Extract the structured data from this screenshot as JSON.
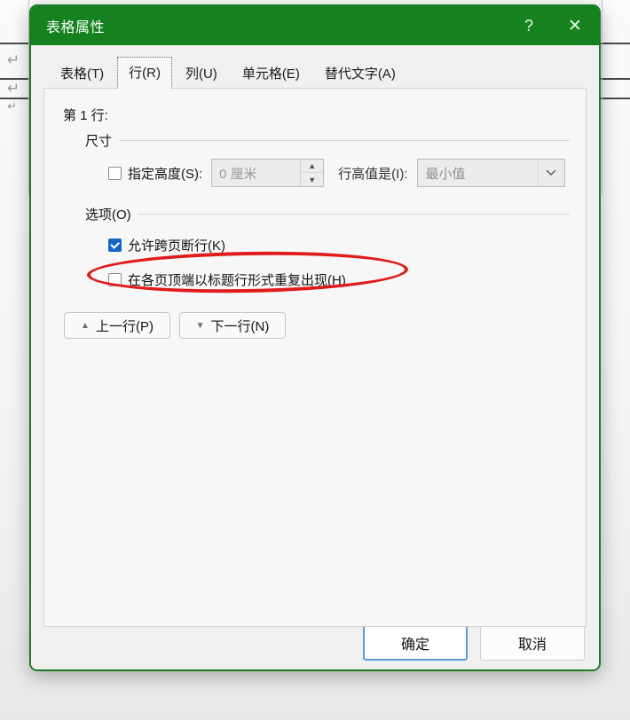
{
  "background": {
    "description": "word-document-table",
    "paragraph_marks": [
      "↵",
      "↵",
      "↵"
    ]
  },
  "dialog": {
    "title": "表格属性",
    "help_icon": "?",
    "close_icon": "✕",
    "accent_color": "#16811f",
    "tabs": [
      {
        "label": "表格(T)",
        "selected": false
      },
      {
        "label": "行(R)",
        "selected": true
      },
      {
        "label": "列(U)",
        "selected": false
      },
      {
        "label": "单元格(E)",
        "selected": false
      },
      {
        "label": "替代文字(A)",
        "selected": false
      }
    ],
    "row_label": "第 1 行:",
    "size_group": {
      "title": "尺寸",
      "specify_height_checkbox": {
        "label": "指定高度(S):",
        "checked": false
      },
      "height_value": "0 厘米",
      "spinner_up_icon": "▲",
      "spinner_down_icon": "▼",
      "row_height_label": "行高值是(I):",
      "row_height_value": "最小值",
      "combo_arrow_icon": "⌵"
    },
    "options_group": {
      "title": "选项(O)",
      "items": [
        {
          "label": "允许跨页断行(K)",
          "checked": true
        },
        {
          "label": "在各页顶端以标题行形式重复出现(H)",
          "checked": false
        }
      ]
    },
    "nav_buttons": [
      {
        "label": "上一行(P)",
        "arrow": "▲"
      },
      {
        "label": "下一行(N)",
        "arrow": "▼"
      }
    ],
    "footer_buttons": [
      {
        "label": "确定",
        "default": true
      },
      {
        "label": "取消",
        "default": false
      }
    ],
    "annotation": {
      "shape": "ellipse",
      "color": "#e01b1b",
      "targets": "在各页顶端以标题行形式重复出现(H)"
    }
  }
}
